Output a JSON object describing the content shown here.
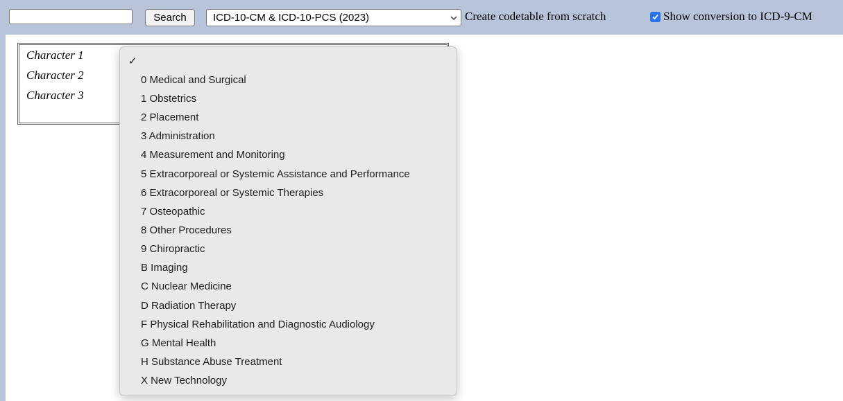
{
  "toolbar": {
    "search_value": "",
    "search_button": "Search",
    "version_selected": "ICD-10-CM & ICD-10-PCS (2023)",
    "create_link": "Create codetable from scratch",
    "show_conversion_label": "Show conversion to ICD-9-CM",
    "show_conversion_checked": true,
    "accent_color": "#2a73e8"
  },
  "characters": [
    {
      "label": "Character 1"
    },
    {
      "label": "Character 2"
    },
    {
      "label": "Character 3"
    }
  ],
  "dropdown": {
    "selected_mark": "✓",
    "options": [
      {
        "label": "0 Medical and Surgical"
      },
      {
        "label": "1 Obstetrics"
      },
      {
        "label": "2 Placement"
      },
      {
        "label": "3 Administration"
      },
      {
        "label": "4 Measurement and Monitoring"
      },
      {
        "label": "5 Extracorporeal or Systemic Assistance and Performance"
      },
      {
        "label": "6 Extracorporeal or Systemic Therapies"
      },
      {
        "label": "7 Osteopathic"
      },
      {
        "label": "8 Other Procedures"
      },
      {
        "label": "9 Chiropractic"
      },
      {
        "label": "B Imaging"
      },
      {
        "label": "C Nuclear Medicine"
      },
      {
        "label": "D Radiation Therapy"
      },
      {
        "label": "F Physical Rehabilitation and Diagnostic Audiology"
      },
      {
        "label": "G Mental Health"
      },
      {
        "label": "H Substance Abuse Treatment"
      },
      {
        "label": "X New Technology"
      }
    ]
  }
}
